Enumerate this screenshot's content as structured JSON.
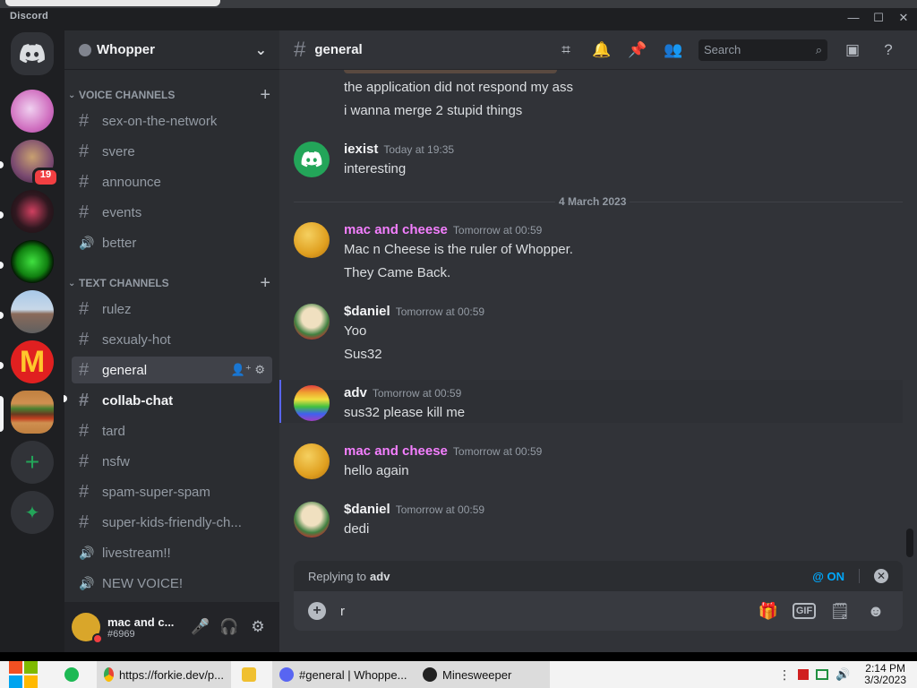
{
  "window": {
    "app_name": "Discord",
    "minimize": "—",
    "maximize": "☐",
    "close": "✕"
  },
  "server_rail": {
    "unread_badge": "19",
    "add_server": "+",
    "explore": "✦"
  },
  "guild": {
    "name": "Whopper",
    "menu": "⌄"
  },
  "categories": {
    "voice": "VOICE CHANNELS",
    "text": "TEXT CHANNELS",
    "add": "+"
  },
  "voice_channels": [
    {
      "name": "sex-on-the-network",
      "icon": "#"
    },
    {
      "name": "svere",
      "icon": "#"
    },
    {
      "name": "announce",
      "icon": "#"
    },
    {
      "name": "events",
      "icon": "#"
    },
    {
      "name": "better",
      "icon": "🔊"
    }
  ],
  "text_channels": [
    {
      "name": "rulez",
      "icon": "#"
    },
    {
      "name": "sexualy-hot",
      "icon": "#"
    },
    {
      "name": "general",
      "icon": "#"
    },
    {
      "name": "collab-chat",
      "icon": "#"
    },
    {
      "name": "tard",
      "icon": "#"
    },
    {
      "name": "nsfw",
      "icon": "#"
    },
    {
      "name": "spam-super-spam",
      "icon": "#"
    },
    {
      "name": "super-kids-friendly-ch...",
      "icon": "#"
    },
    {
      "name": "livestream!!",
      "icon": "🔊"
    },
    {
      "name": "NEW VOICE!",
      "icon": "🔊"
    }
  ],
  "active_channel_tools": "👤⁺ ⚙",
  "user_panel": {
    "name": "mac and c...",
    "tag": "#6969",
    "mic": "🎤",
    "headset": "🎧",
    "settings": "⚙"
  },
  "chat_header": {
    "channel": "general",
    "search_placeholder": "Search"
  },
  "messages": {
    "cont1": "the application did not respond my ass",
    "cont2": "i wanna merge 2 stupid things",
    "m1": {
      "author": "iexist",
      "time": "Today at 19:35",
      "lines": [
        "interesting"
      ]
    },
    "date_divider": "4 March 2023",
    "m2": {
      "author": "mac and cheese",
      "time": "Tomorrow at 00:59",
      "lines": [
        "Mac n Cheese is the ruler of Whopper.",
        "They Came Back."
      ]
    },
    "m3": {
      "author": "$daniel",
      "time": "Tomorrow at 00:59",
      "lines": [
        "Yoo",
        "Sus32"
      ]
    },
    "m4": {
      "author": "adv",
      "time": "Tomorrow at 00:59",
      "lines": [
        "sus32 please kill me"
      ]
    },
    "m5": {
      "author": "mac and cheese",
      "time": "Tomorrow at 00:59",
      "lines": [
        "hello again"
      ]
    },
    "m6": {
      "author": "$daniel",
      "time": "Tomorrow at 00:59",
      "lines": [
        "dedi"
      ]
    }
  },
  "colors": {
    "mac_and_cheese": "#f47fff",
    "default_author": "#f2f3f5",
    "blurple": "#5865f2",
    "green": "#23a559"
  },
  "reply_bar": {
    "prefix": "Replying to",
    "target": "adv",
    "mention_toggle": "@ ON",
    "close": "✕"
  },
  "composer": {
    "value": "r",
    "gif": "GIF"
  },
  "taskbar": {
    "items": [
      {
        "label": "https://forkie.dev/p..."
      },
      {
        "label": "#general | Whoppe..."
      },
      {
        "label": "Minesweeper"
      }
    ],
    "time": "2:14 PM",
    "date": "3/3/2023"
  }
}
